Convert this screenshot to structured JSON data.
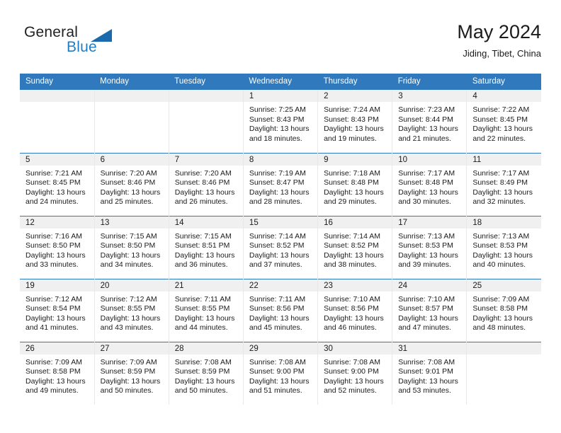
{
  "brand": {
    "name_top": "General",
    "name_bottom": "Blue",
    "accent_color": "#1f7dc4",
    "triangle_color": "#1a6aad",
    "triangle_icon": "triangle-up-right-icon"
  },
  "header": {
    "month_title": "May 2024",
    "location": "Jiding, Tibet, China",
    "header_bg": "#2f79bc",
    "daynum_bg": "#f0f0f0"
  },
  "weekday_headers": [
    "Sunday",
    "Monday",
    "Tuesday",
    "Wednesday",
    "Thursday",
    "Friday",
    "Saturday"
  ],
  "labels": {
    "sunrise_prefix": "Sunrise: ",
    "sunset_prefix": "Sunset: ",
    "daylight_prefix": "Daylight: "
  },
  "weeks": [
    [
      {
        "day": "",
        "empty": true
      },
      {
        "day": "",
        "empty": true
      },
      {
        "day": "",
        "empty": true
      },
      {
        "day": "1",
        "sunrise": "Sunrise: 7:25 AM",
        "sunset": "Sunset: 8:43 PM",
        "daylight_l1": "Daylight: 13 hours",
        "daylight_l2": "and 18 minutes."
      },
      {
        "day": "2",
        "sunrise": "Sunrise: 7:24 AM",
        "sunset": "Sunset: 8:43 PM",
        "daylight_l1": "Daylight: 13 hours",
        "daylight_l2": "and 19 minutes."
      },
      {
        "day": "3",
        "sunrise": "Sunrise: 7:23 AM",
        "sunset": "Sunset: 8:44 PM",
        "daylight_l1": "Daylight: 13 hours",
        "daylight_l2": "and 21 minutes."
      },
      {
        "day": "4",
        "sunrise": "Sunrise: 7:22 AM",
        "sunset": "Sunset: 8:45 PM",
        "daylight_l1": "Daylight: 13 hours",
        "daylight_l2": "and 22 minutes."
      }
    ],
    [
      {
        "day": "5",
        "sunrise": "Sunrise: 7:21 AM",
        "sunset": "Sunset: 8:45 PM",
        "daylight_l1": "Daylight: 13 hours",
        "daylight_l2": "and 24 minutes."
      },
      {
        "day": "6",
        "sunrise": "Sunrise: 7:20 AM",
        "sunset": "Sunset: 8:46 PM",
        "daylight_l1": "Daylight: 13 hours",
        "daylight_l2": "and 25 minutes."
      },
      {
        "day": "7",
        "sunrise": "Sunrise: 7:20 AM",
        "sunset": "Sunset: 8:46 PM",
        "daylight_l1": "Daylight: 13 hours",
        "daylight_l2": "and 26 minutes."
      },
      {
        "day": "8",
        "sunrise": "Sunrise: 7:19 AM",
        "sunset": "Sunset: 8:47 PM",
        "daylight_l1": "Daylight: 13 hours",
        "daylight_l2": "and 28 minutes."
      },
      {
        "day": "9",
        "sunrise": "Sunrise: 7:18 AM",
        "sunset": "Sunset: 8:48 PM",
        "daylight_l1": "Daylight: 13 hours",
        "daylight_l2": "and 29 minutes."
      },
      {
        "day": "10",
        "sunrise": "Sunrise: 7:17 AM",
        "sunset": "Sunset: 8:48 PM",
        "daylight_l1": "Daylight: 13 hours",
        "daylight_l2": "and 30 minutes."
      },
      {
        "day": "11",
        "sunrise": "Sunrise: 7:17 AM",
        "sunset": "Sunset: 8:49 PM",
        "daylight_l1": "Daylight: 13 hours",
        "daylight_l2": "and 32 minutes."
      }
    ],
    [
      {
        "day": "12",
        "sunrise": "Sunrise: 7:16 AM",
        "sunset": "Sunset: 8:50 PM",
        "daylight_l1": "Daylight: 13 hours",
        "daylight_l2": "and 33 minutes."
      },
      {
        "day": "13",
        "sunrise": "Sunrise: 7:15 AM",
        "sunset": "Sunset: 8:50 PM",
        "daylight_l1": "Daylight: 13 hours",
        "daylight_l2": "and 34 minutes."
      },
      {
        "day": "14",
        "sunrise": "Sunrise: 7:15 AM",
        "sunset": "Sunset: 8:51 PM",
        "daylight_l1": "Daylight: 13 hours",
        "daylight_l2": "and 36 minutes."
      },
      {
        "day": "15",
        "sunrise": "Sunrise: 7:14 AM",
        "sunset": "Sunset: 8:52 PM",
        "daylight_l1": "Daylight: 13 hours",
        "daylight_l2": "and 37 minutes."
      },
      {
        "day": "16",
        "sunrise": "Sunrise: 7:14 AM",
        "sunset": "Sunset: 8:52 PM",
        "daylight_l1": "Daylight: 13 hours",
        "daylight_l2": "and 38 minutes."
      },
      {
        "day": "17",
        "sunrise": "Sunrise: 7:13 AM",
        "sunset": "Sunset: 8:53 PM",
        "daylight_l1": "Daylight: 13 hours",
        "daylight_l2": "and 39 minutes."
      },
      {
        "day": "18",
        "sunrise": "Sunrise: 7:13 AM",
        "sunset": "Sunset: 8:53 PM",
        "daylight_l1": "Daylight: 13 hours",
        "daylight_l2": "and 40 minutes."
      }
    ],
    [
      {
        "day": "19",
        "sunrise": "Sunrise: 7:12 AM",
        "sunset": "Sunset: 8:54 PM",
        "daylight_l1": "Daylight: 13 hours",
        "daylight_l2": "and 41 minutes."
      },
      {
        "day": "20",
        "sunrise": "Sunrise: 7:12 AM",
        "sunset": "Sunset: 8:55 PM",
        "daylight_l1": "Daylight: 13 hours",
        "daylight_l2": "and 43 minutes."
      },
      {
        "day": "21",
        "sunrise": "Sunrise: 7:11 AM",
        "sunset": "Sunset: 8:55 PM",
        "daylight_l1": "Daylight: 13 hours",
        "daylight_l2": "and 44 minutes."
      },
      {
        "day": "22",
        "sunrise": "Sunrise: 7:11 AM",
        "sunset": "Sunset: 8:56 PM",
        "daylight_l1": "Daylight: 13 hours",
        "daylight_l2": "and 45 minutes."
      },
      {
        "day": "23",
        "sunrise": "Sunrise: 7:10 AM",
        "sunset": "Sunset: 8:56 PM",
        "daylight_l1": "Daylight: 13 hours",
        "daylight_l2": "and 46 minutes."
      },
      {
        "day": "24",
        "sunrise": "Sunrise: 7:10 AM",
        "sunset": "Sunset: 8:57 PM",
        "daylight_l1": "Daylight: 13 hours",
        "daylight_l2": "and 47 minutes."
      },
      {
        "day": "25",
        "sunrise": "Sunrise: 7:09 AM",
        "sunset": "Sunset: 8:58 PM",
        "daylight_l1": "Daylight: 13 hours",
        "daylight_l2": "and 48 minutes."
      }
    ],
    [
      {
        "day": "26",
        "sunrise": "Sunrise: 7:09 AM",
        "sunset": "Sunset: 8:58 PM",
        "daylight_l1": "Daylight: 13 hours",
        "daylight_l2": "and 49 minutes."
      },
      {
        "day": "27",
        "sunrise": "Sunrise: 7:09 AM",
        "sunset": "Sunset: 8:59 PM",
        "daylight_l1": "Daylight: 13 hours",
        "daylight_l2": "and 50 minutes."
      },
      {
        "day": "28",
        "sunrise": "Sunrise: 7:08 AM",
        "sunset": "Sunset: 8:59 PM",
        "daylight_l1": "Daylight: 13 hours",
        "daylight_l2": "and 50 minutes."
      },
      {
        "day": "29",
        "sunrise": "Sunrise: 7:08 AM",
        "sunset": "Sunset: 9:00 PM",
        "daylight_l1": "Daylight: 13 hours",
        "daylight_l2": "and 51 minutes."
      },
      {
        "day": "30",
        "sunrise": "Sunrise: 7:08 AM",
        "sunset": "Sunset: 9:00 PM",
        "daylight_l1": "Daylight: 13 hours",
        "daylight_l2": "and 52 minutes."
      },
      {
        "day": "31",
        "sunrise": "Sunrise: 7:08 AM",
        "sunset": "Sunset: 9:01 PM",
        "daylight_l1": "Daylight: 13 hours",
        "daylight_l2": "and 53 minutes."
      },
      {
        "day": "",
        "empty": true
      }
    ]
  ]
}
